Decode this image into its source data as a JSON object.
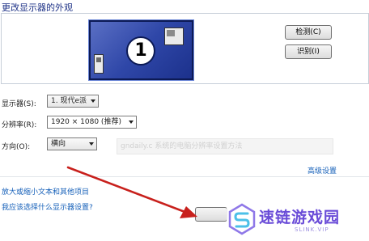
{
  "page": {
    "title": "更改显示器的外观"
  },
  "preview": {
    "monitor_number": "1"
  },
  "buttons": {
    "detect": "检测(C)",
    "identify": "识别(I)"
  },
  "settings": {
    "display": {
      "label": "显示器(S):",
      "value": "1. 现代e派"
    },
    "resolution": {
      "label": "分辨率(R):",
      "value": "1920 × 1080 (推荐)"
    },
    "orientation": {
      "label": "方向(O):",
      "value": "横向"
    }
  },
  "overlay_caption": "gndaily.c 系统的电脑分辨率设置方法",
  "links": {
    "advanced": "高级设置",
    "text_size": "放大或缩小文本和其他项目",
    "which_setting": "我应该选择什么显示器设置?"
  },
  "watermark": {
    "name": "速链游戏园",
    "url": "SLINK.VIP"
  },
  "colors": {
    "accent_link": "#1660b9",
    "title": "#1e3287",
    "arrow": "#c8201c",
    "watermark": "#6a4cd8"
  }
}
